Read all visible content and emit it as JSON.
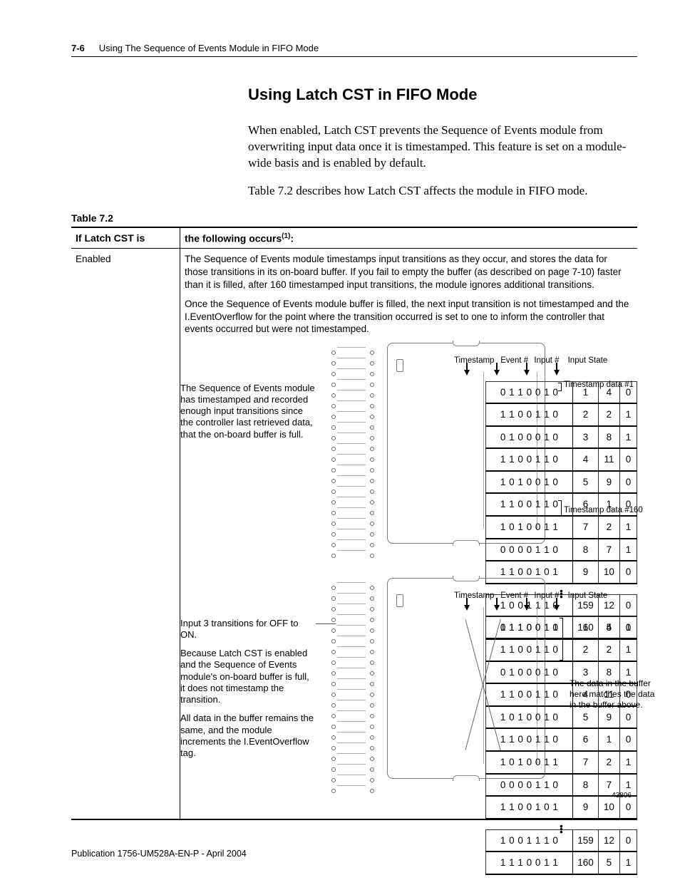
{
  "header": {
    "page_number": "7-6",
    "running_title": "Using The Sequence of Events Module in FIFO Mode"
  },
  "section": {
    "title": "Using Latch CST in FIFO Mode",
    "para1": "When enabled, Latch CST prevents the Sequence of Events module from overwriting input data once it is timestamped. This feature is set on a module-wide basis and is enabled by default.",
    "para2": "Table 7.2 describes how Latch CST affects the module in FIFO mode."
  },
  "table": {
    "label": "Table 7.2",
    "head_col1": "If Latch CST is",
    "head_col2_pre": "the following occurs",
    "head_col2_sup": "(1)",
    "head_col2_post": ":",
    "row1_col1": "Enabled",
    "row1_col2_p1": "The Sequence of Events module timestamps input transitions as they occur, and stores the data for those transitions in its on-board buffer. If you fail to empty the buffer (as described on page 7-10) faster than it is filled, after 160 timestamped input transitions, the module ignores additional transitions.",
    "row1_col2_p2": "Once the Sequence of Events module buffer is filled, the next input transition is not timestamped and the I.EventOverflow for the point where the transition occurred is set to one to inform the controller that events occurred but were not timestamped."
  },
  "diagram1": {
    "annot_left": "The Sequence of Events module has timestamped and recorded enough input transitions since the controller last retrieved data, that the on-board buffer is full.",
    "col_timestamp": "Timestamp",
    "col_event": "Event #",
    "col_input": "Input #",
    "col_state": "Input State",
    "side_top": "Timestamp data #1",
    "side_bottom": "Timestamp data #160",
    "rows": [
      {
        "ts": "0 1 1 0 0 1 0",
        "ev": "1",
        "in": "4",
        "st": "0"
      },
      {
        "ts": "1 1 0 0 1 1 0",
        "ev": "2",
        "in": "2",
        "st": "1"
      },
      {
        "ts": "0 1 0 0 0 1 0",
        "ev": "3",
        "in": "8",
        "st": "1"
      },
      {
        "ts": "1 1 0 0 1 1 0",
        "ev": "4",
        "in": "11",
        "st": "0"
      },
      {
        "ts": "1 0 1 0 0 1 0",
        "ev": "5",
        "in": "9",
        "st": "0"
      },
      {
        "ts": "1 1 0 0 1 1 0",
        "ev": "6",
        "in": "1",
        "st": "0"
      },
      {
        "ts": "1 0 1 0 0 1 1",
        "ev": "7",
        "in": "2",
        "st": "1"
      },
      {
        "ts": "0 0 0 0 1 1 0",
        "ev": "8",
        "in": "7",
        "st": "1"
      },
      {
        "ts": "1 1 0 0 1 0 1",
        "ev": "9",
        "in": "10",
        "st": "0"
      }
    ],
    "rows_bottom": [
      {
        "ts": "1 0 0 1 1 1 0",
        "ev": "159",
        "in": "12",
        "st": "0"
      },
      {
        "ts": "1 1 1 0 0 1 1",
        "ev": "160",
        "in": "5",
        "st": "1"
      }
    ]
  },
  "diagram2": {
    "annot_left_a": "Input 3 transitions for OFF to ON.",
    "annot_left_b": "Because Latch CST is enabled and the Sequence of Events module's on-board buffer is full, it does not timestamp the transition.",
    "annot_left_c": "All data in the buffer remains the same, and the module increments the I.EventOverflow tag.",
    "annot_right": "The data in the buffer here matches the data in the buffer above.",
    "col_timestamp": "Timestamp",
    "col_event": "Event #",
    "col_input": "Input #",
    "col_state": "Input State",
    "rows": [
      {
        "ts": "0 1 1 0 0 1 0",
        "ev": "1",
        "in": "4",
        "st": "0"
      },
      {
        "ts": "1 1 0 0 1 1 0",
        "ev": "2",
        "in": "2",
        "st": "1"
      },
      {
        "ts": "0 1 0 0 0 1 0",
        "ev": "3",
        "in": "8",
        "st": "1"
      },
      {
        "ts": "1 1 0 0 1 1 0",
        "ev": "4",
        "in": "11",
        "st": "0"
      },
      {
        "ts": "1 0 1 0 0 1 0",
        "ev": "5",
        "in": "9",
        "st": "0"
      },
      {
        "ts": "1 1 0 0 1 1 0",
        "ev": "6",
        "in": "1",
        "st": "0"
      },
      {
        "ts": "1 0 1 0 0 1 1",
        "ev": "7",
        "in": "2",
        "st": "1"
      },
      {
        "ts": "0 0 0 0 1 1 0",
        "ev": "8",
        "in": "7",
        "st": "1"
      },
      {
        "ts": "1 1 0 0 1 0 1",
        "ev": "9",
        "in": "10",
        "st": "0"
      }
    ],
    "rows_bottom": [
      {
        "ts": "1 0 0 1 1 1 0",
        "ev": "159",
        "in": "12",
        "st": "0"
      },
      {
        "ts": "1 1 1 0 0 1 1",
        "ev": "160",
        "in": "5",
        "st": "1"
      }
    ],
    "fig_ref": "43806"
  },
  "footer": {
    "text": "Publication 1756-UM528A-EN-P - April 2004"
  }
}
